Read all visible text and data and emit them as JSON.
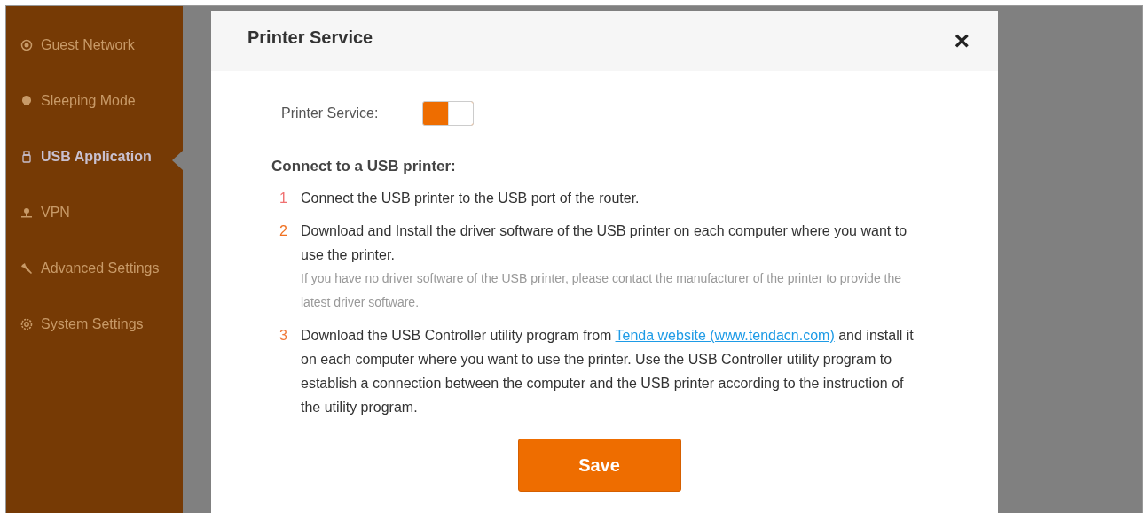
{
  "sidebar": {
    "items": [
      {
        "label": "Guest Network",
        "selected": false
      },
      {
        "label": "Sleeping Mode",
        "selected": false
      },
      {
        "label": "USB Application",
        "selected": true
      },
      {
        "label": "VPN",
        "selected": false
      },
      {
        "label": "Advanced Settings",
        "selected": false
      },
      {
        "label": "System Settings",
        "selected": false
      }
    ]
  },
  "dialog": {
    "title": "Printer Service",
    "close": "×",
    "toggle": {
      "label": "Printer Service:",
      "on": true
    },
    "heading": "Connect to a USB printer:",
    "steps": [
      {
        "number": "1",
        "color": "#f07070",
        "text": "Connect the USB printer to the USB port of the router."
      },
      {
        "number": "2",
        "color": "#f07020",
        "text": "Download and Install the driver software of the USB printer on each computer where you want to use the printer.",
        "note": "If you have no driver software of the USB printer, please contact the manufacturer of the printer to provide the latest driver software."
      },
      {
        "number": "3",
        "color": "#f07838",
        "text": "Download the USB Controller utility program from",
        "link": "Tenda website (www.tendacn.com)",
        "text_after": "and install it on each computer where you want to use the printer. Use the USB Controller utility program to establish a connection between the computer and the USB printer according to the instruction of the utility program."
      }
    ],
    "save": "Save"
  }
}
